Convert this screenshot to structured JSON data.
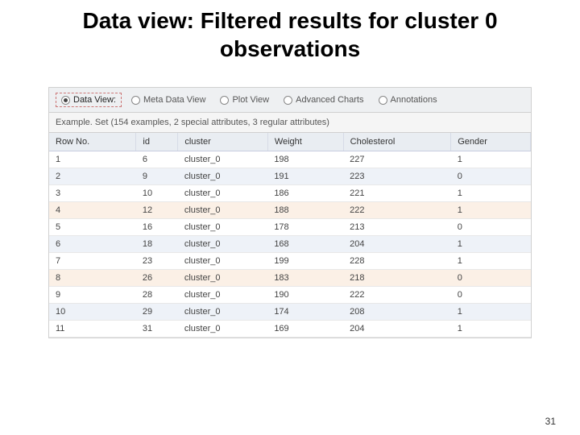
{
  "title": "Data view: Filtered results for cluster 0 observations",
  "tabs": {
    "data_view": "Data View:",
    "meta_data_view": "Meta Data View",
    "plot_view": "Plot View",
    "advanced_charts": "Advanced Charts",
    "annotations": "Annotations"
  },
  "info": "Example. Set (154 examples, 2 special attributes, 3 regular attributes)",
  "columns": {
    "row_no": "Row No.",
    "id": "id",
    "cluster": "cluster",
    "weight": "Weight",
    "cholesterol": "Cholesterol",
    "gender": "Gender"
  },
  "rows": [
    {
      "row_no": "1",
      "id": "6",
      "cluster": "cluster_0",
      "weight": "198",
      "chol": "227",
      "gender": "1"
    },
    {
      "row_no": "2",
      "id": "9",
      "cluster": "cluster_0",
      "weight": "191",
      "chol": "223",
      "gender": "0"
    },
    {
      "row_no": "3",
      "id": "10",
      "cluster": "cluster_0",
      "weight": "186",
      "chol": "221",
      "gender": "1"
    },
    {
      "row_no": "4",
      "id": "12",
      "cluster": "cluster_0",
      "weight": "188",
      "chol": "222",
      "gender": "1"
    },
    {
      "row_no": "5",
      "id": "16",
      "cluster": "cluster_0",
      "weight": "178",
      "chol": "213",
      "gender": "0"
    },
    {
      "row_no": "6",
      "id": "18",
      "cluster": "cluster_0",
      "weight": "168",
      "chol": "204",
      "gender": "1"
    },
    {
      "row_no": "7",
      "id": "23",
      "cluster": "cluster_0",
      "weight": "199",
      "chol": "228",
      "gender": "1"
    },
    {
      "row_no": "8",
      "id": "26",
      "cluster": "cluster_0",
      "weight": "183",
      "chol": "218",
      "gender": "0"
    },
    {
      "row_no": "9",
      "id": "28",
      "cluster": "cluster_0",
      "weight": "190",
      "chol": "222",
      "gender": "0"
    },
    {
      "row_no": "10",
      "id": "29",
      "cluster": "cluster_0",
      "weight": "174",
      "chol": "208",
      "gender": "1"
    },
    {
      "row_no": "11",
      "id": "31",
      "cluster": "cluster_0",
      "weight": "169",
      "chol": "204",
      "gender": "1"
    }
  ],
  "page_number": "31"
}
